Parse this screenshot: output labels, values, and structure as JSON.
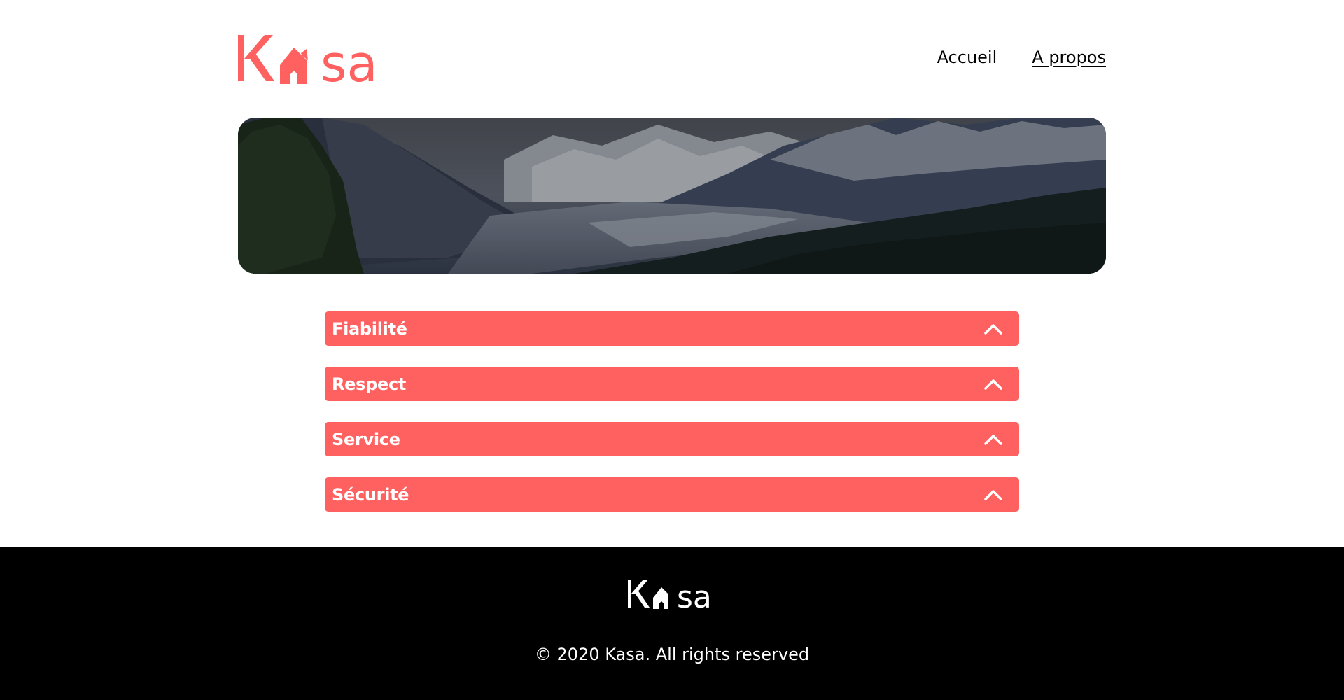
{
  "brand": {
    "name": "Kasa",
    "accent_color": "#FF6060"
  },
  "nav": {
    "items": [
      {
        "label": "Accueil",
        "active": false
      },
      {
        "label": "A propos",
        "active": true
      }
    ]
  },
  "banner": {
    "image": "mountain-landscape"
  },
  "accordion": {
    "items": [
      {
        "title": "Fiabilité",
        "icon": "chevron-up-icon"
      },
      {
        "title": "Respect",
        "icon": "chevron-up-icon"
      },
      {
        "title": "Service",
        "icon": "chevron-up-icon"
      },
      {
        "title": "Sécurité",
        "icon": "chevron-up-icon"
      }
    ]
  },
  "footer": {
    "copyright": "© 2020 Kasa. All rights reserved",
    "background": "#000000"
  }
}
